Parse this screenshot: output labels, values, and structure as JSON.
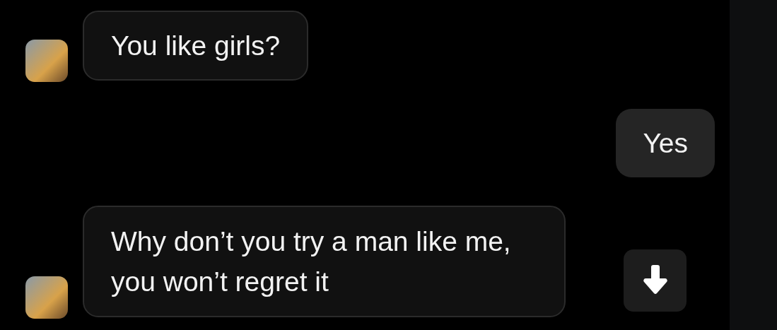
{
  "messages": [
    {
      "kind": "incoming",
      "text": "You like girls?"
    },
    {
      "kind": "outgoing",
      "text": "Yes"
    },
    {
      "kind": "incoming",
      "text": "Why don’t you try a man like me, you won’t regret it"
    }
  ]
}
